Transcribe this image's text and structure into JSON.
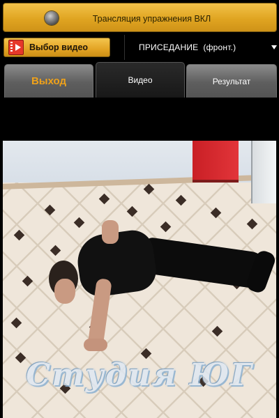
{
  "top_bar": {
    "label": "Трансляция упражнения ВКЛ",
    "indicator_icon": "led-indicator-icon"
  },
  "toolbar": {
    "video_button_label": "Выбор видео",
    "video_button_icon": "film-play-icon",
    "exercise_select_value": "ПРИСЕДАНИЕ  (фронт.)",
    "exercise_select_icon": "chevron-down-icon"
  },
  "tabs": [
    {
      "label": "Выход",
      "active": false
    },
    {
      "label": "Видео",
      "active": true
    },
    {
      "label": "Результат",
      "active": false
    }
  ],
  "video": {
    "watermark": "Студия ЮГ"
  },
  "colors": {
    "accent_orange": "#e3a424",
    "exit_tab_text": "#f0a21a",
    "background": "#000000"
  }
}
